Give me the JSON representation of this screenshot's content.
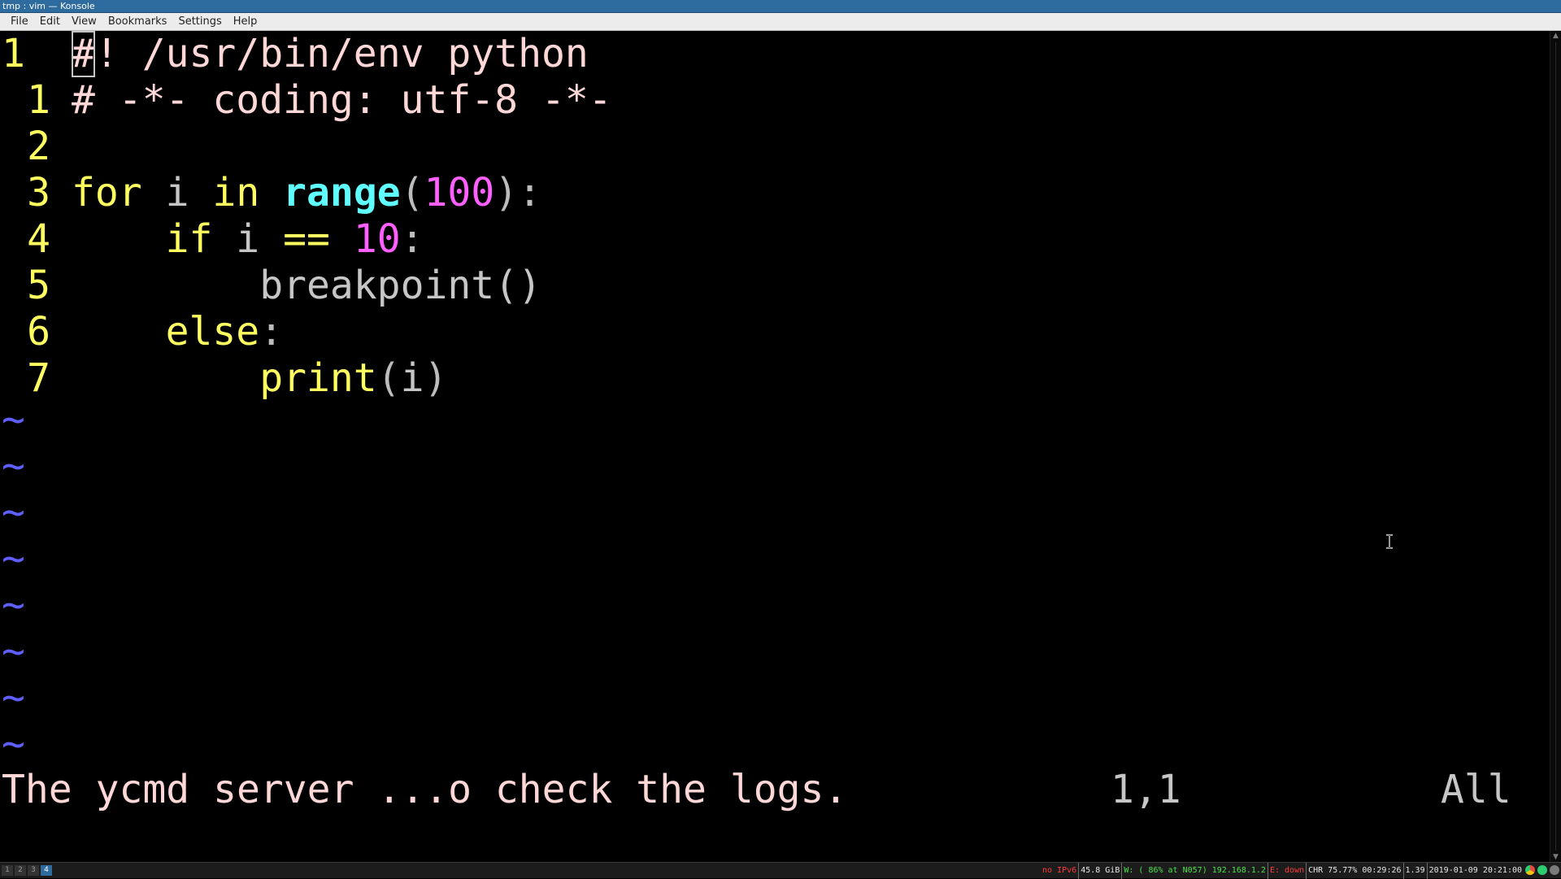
{
  "window": {
    "title": "tmp : vim — Konsole"
  },
  "menu": [
    "File",
    "Edit",
    "View",
    "Bookmarks",
    "Settings",
    "Help"
  ],
  "editor": {
    "lines": [
      {
        "num": "1",
        "segments": [
          {
            "t": "#",
            "c": "cmt",
            "cursor": true
          },
          {
            "t": "! /usr/bin/env python",
            "c": "cmt"
          }
        ]
      },
      {
        "num": "1",
        "segments": [
          {
            "t": "# -*- coding: utf-8 -*-",
            "c": "cmt"
          }
        ]
      },
      {
        "num": "2",
        "segments": []
      },
      {
        "num": "3",
        "segments": [
          {
            "t": "for",
            "c": "kw"
          },
          {
            "t": " ",
            "c": "id"
          },
          {
            "t": "i",
            "c": "id"
          },
          {
            "t": " ",
            "c": "id"
          },
          {
            "t": "in",
            "c": "kw"
          },
          {
            "t": " ",
            "c": "id"
          },
          {
            "t": "range",
            "c": "fn"
          },
          {
            "t": "(",
            "c": "pun"
          },
          {
            "t": "100",
            "c": "num"
          },
          {
            "t": "):",
            "c": "pun"
          }
        ]
      },
      {
        "num": "4",
        "segments": [
          {
            "t": "    ",
            "c": "id"
          },
          {
            "t": "if",
            "c": "kw"
          },
          {
            "t": " ",
            "c": "id"
          },
          {
            "t": "i",
            "c": "id"
          },
          {
            "t": " ",
            "c": "id"
          },
          {
            "t": "==",
            "c": "kw"
          },
          {
            "t": " ",
            "c": "id"
          },
          {
            "t": "10",
            "c": "num"
          },
          {
            "t": ":",
            "c": "pun"
          }
        ]
      },
      {
        "num": "5",
        "segments": [
          {
            "t": "        ",
            "c": "id"
          },
          {
            "t": "breakpoint()",
            "c": "id"
          }
        ]
      },
      {
        "num": "6",
        "segments": [
          {
            "t": "    ",
            "c": "id"
          },
          {
            "t": "else",
            "c": "kw"
          },
          {
            "t": ":",
            "c": "pun"
          }
        ]
      },
      {
        "num": "7",
        "segments": [
          {
            "t": "        ",
            "c": "id"
          },
          {
            "t": "print",
            "c": "kw"
          },
          {
            "t": "(",
            "c": "pun"
          },
          {
            "t": "i",
            "c": "id"
          },
          {
            "t": ")",
            "c": "pun"
          }
        ]
      }
    ],
    "tildes": [
      "~",
      "~",
      "~",
      "~",
      "~",
      "~",
      "~",
      "~"
    ],
    "message": "The ycmd server ...o check the logs.",
    "position": "1,1",
    "scroll": "All"
  },
  "taskbar": {
    "desktops": [
      "1",
      "2",
      "3",
      "4"
    ],
    "active_desktop": "4",
    "status": {
      "ipv6": "no IPv6",
      "disk": "45.8 GiB",
      "wifi": "W: ( 86% at N057) 192.168.1.2",
      "ethernet": "E: down",
      "battery": "CHR 75.77% 00:29:26",
      "load": "1.39",
      "datetime": "2019-01-09 20:21:00"
    }
  },
  "colors": {
    "line_number": "#ffff5f",
    "keyword": "#ffff5f",
    "builtin": "#5fffff",
    "number": "#ff5fff",
    "comment": "#ffd7d7",
    "tilde": "#5f5fff"
  }
}
